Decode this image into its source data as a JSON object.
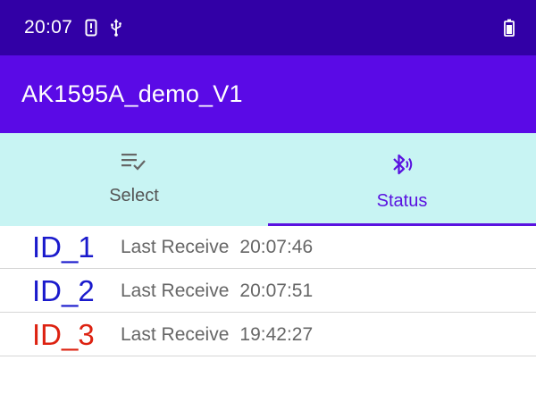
{
  "status_bar": {
    "time": "20:07",
    "icons": [
      "phone-alert-icon",
      "usb-icon",
      "battery-icon"
    ]
  },
  "app_bar": {
    "title": "AK1595A_demo_V1"
  },
  "tabs": [
    {
      "label": "Select",
      "icon": "playlist-check-icon",
      "active": false
    },
    {
      "label": "Status",
      "icon": "bluetooth-audio-icon",
      "active": true
    }
  ],
  "devices": [
    {
      "id": "ID_1",
      "label": "Last Receive",
      "time": "20:07:46",
      "color": "#1a1acc"
    },
    {
      "id": "ID_2",
      "label": "Last Receive",
      "time": "20:07:51",
      "color": "#1a1acc"
    },
    {
      "id": "ID_3",
      "label": "Last Receive",
      "time": "19:42:27",
      "color": "#dd2211"
    }
  ],
  "colors": {
    "status_bar": "#3200a6",
    "app_bar": "#5a0ae6",
    "tab_bar": "#c8f4f3",
    "accent": "#5a12e0"
  }
}
